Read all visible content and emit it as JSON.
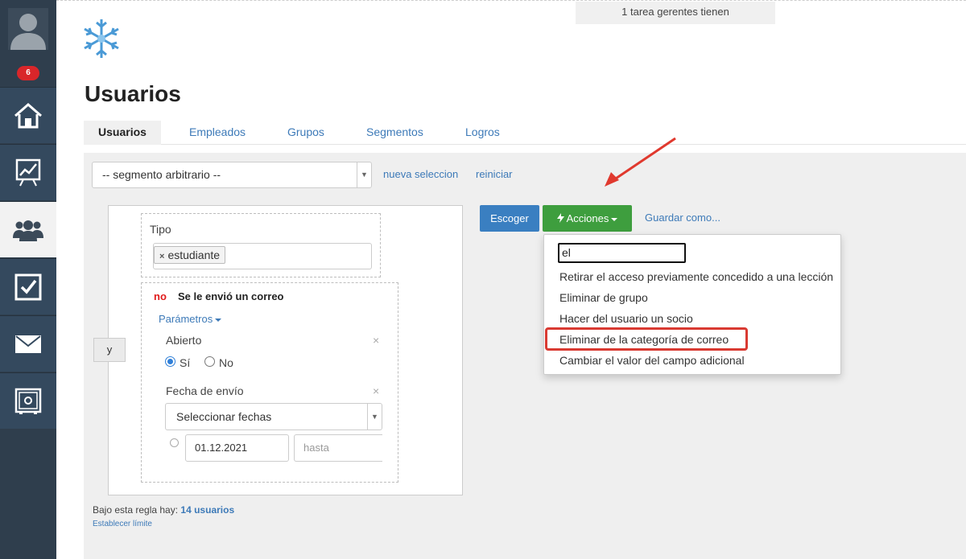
{
  "sidebar": {
    "badge": "6",
    "items": [
      {
        "icon": "home-icon"
      },
      {
        "icon": "chart-icon"
      },
      {
        "icon": "users-icon",
        "active": true
      },
      {
        "icon": "checkbox-icon"
      },
      {
        "icon": "mail-icon"
      },
      {
        "icon": "safe-icon"
      }
    ]
  },
  "header": {
    "notice": "1 tarea gerentes tienen",
    "title": "Usuarios"
  },
  "tabs": [
    "Usuarios",
    "Empleados",
    "Grupos",
    "Segmentos",
    "Logros"
  ],
  "segment": {
    "selected": "-- segmento arbitrario --",
    "new_selection": "nueva seleccion",
    "reset": "reiniciar"
  },
  "rules": {
    "operator": "y",
    "type_label": "Tipo",
    "type_tag": "estudiante",
    "negation": "no",
    "condition_title": "Se le envió un correo",
    "params_link": "Parámetros",
    "opened_label": "Abierto",
    "radio_yes": "Sí",
    "radio_no": "No",
    "send_date_label": "Fecha de envío",
    "date_select": "Seleccionar fechas",
    "date_from": "01.12.2021",
    "date_to_placeholder": "hasta"
  },
  "rule_summary": {
    "prefix": "Bajo esta regla hay:",
    "count": "14 usuarios",
    "limit_link": "Establecer límite"
  },
  "actions": {
    "choose": "Escoger",
    "actions": "Acciones",
    "save_as": "Guardar como...",
    "search_value": "el",
    "items": [
      "Retirar el acceso previamente concedido a una lección",
      "Eliminar de grupo",
      "Hacer del usuario un socio",
      "Eliminar de la categoría de correo",
      "Cambiar el valor del campo adicional"
    ]
  },
  "colors": {
    "sidebar": "#34495e",
    "accent_blue": "#3a7fc1",
    "accent_green": "#3e9e3e",
    "annotation_red": "#d93a32"
  }
}
